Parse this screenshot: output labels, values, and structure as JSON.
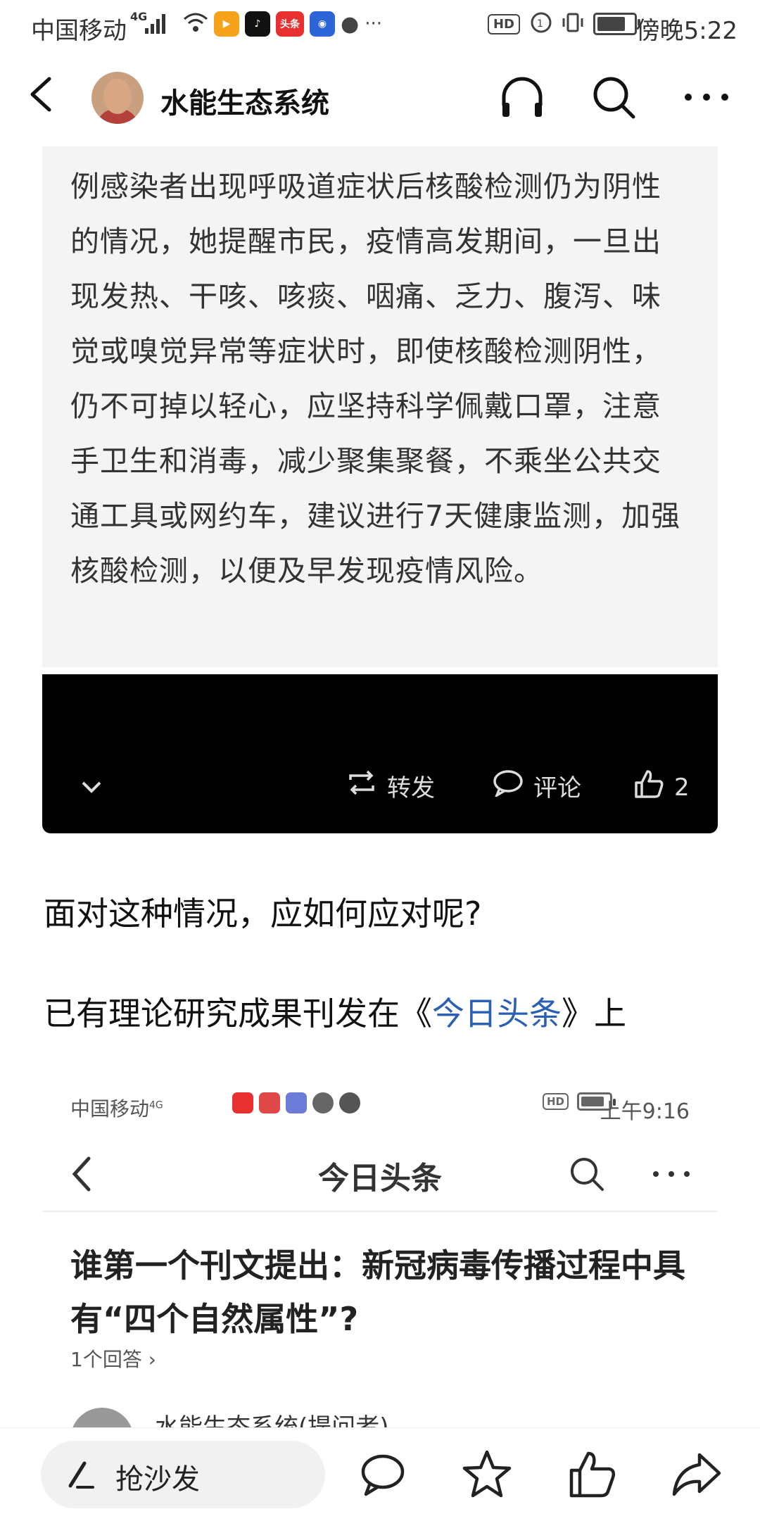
{
  "status_bar": {
    "carrier": "中国移动",
    "network": "4G",
    "time": "傍晚5:22",
    "hd": "HD"
  },
  "nav": {
    "title": "水能生态系统",
    "icons": [
      "back-icon",
      "headphones-icon",
      "search-icon",
      "more-icon"
    ]
  },
  "excerpt": {
    "text": "例感染者出现呼吸道症状后核酸检测仍为阴性的情况，她提醒市民，疫情高发期间，一旦出现发热、干咳、咳痰、咽痛、乏力、腹泻、味觉或嗅觉异常等症状时，即使核酸检测阴性，仍不可掉以轻心，应坚持科学佩戴口罩，注意手卫生和消毒，减少聚集聚餐，不乘坐公共交通工具或网约车，建议进行7天健康监测，加强核酸检测，以便及早发现疫情风险。",
    "actions": {
      "repost": "转发",
      "comment": "评论",
      "like_count": "2"
    }
  },
  "body": {
    "p1": "面对这种情况，应如何应对呢?",
    "p2_prefix": "已有理论研究成果刊发在《",
    "p2_link": "今日头条",
    "p2_suffix": "》上"
  },
  "embedded": {
    "carrier": "中国移动",
    "network": "4G",
    "hd": "HD",
    "time": "上午9:16",
    "title": "今日头条",
    "question": "谁第一个刊文提出：新冠病毒传播过程中具有“四个自然属性”?",
    "answers": "1个回答 ›",
    "author": "水能生态系统(提问者)"
  },
  "bottom_bar": {
    "comment_placeholder": "抢沙发",
    "icons": [
      "comment-icon",
      "star-icon",
      "like-icon",
      "share-icon"
    ]
  },
  "colors": {
    "link": "#2a5fb4",
    "excerpt_bg": "#f5f4f5",
    "video_bg": "#000000"
  }
}
